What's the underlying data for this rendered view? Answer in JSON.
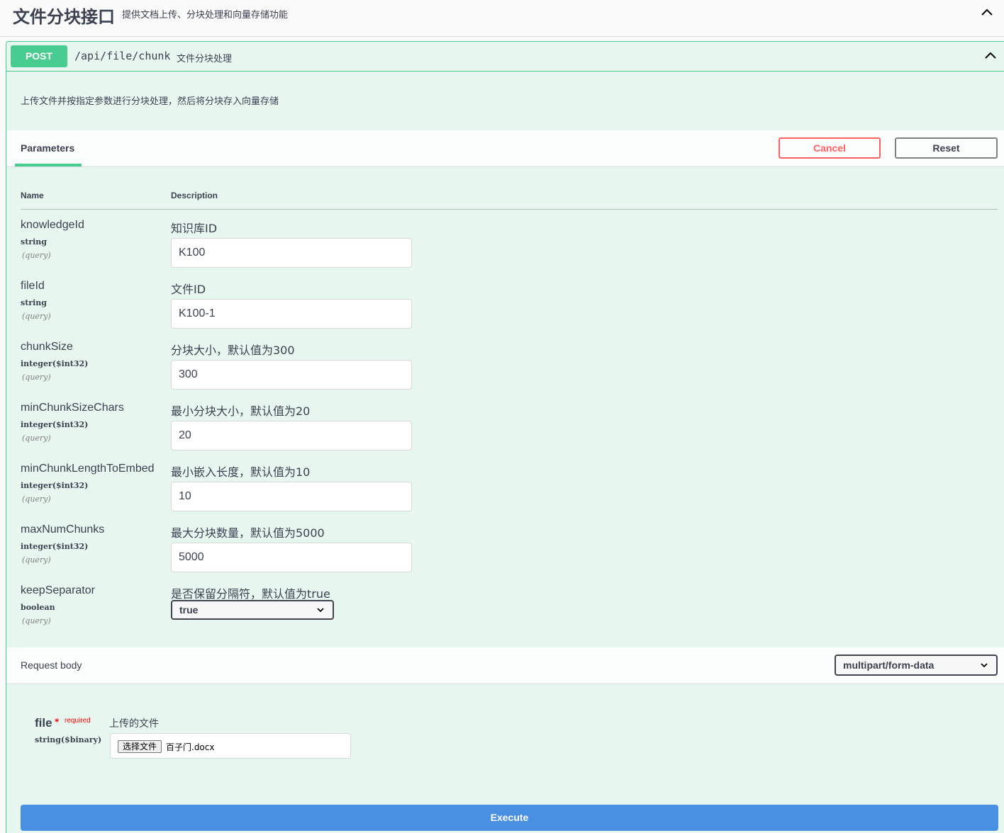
{
  "tag": {
    "title": "文件分块接口",
    "description": "提供文档上传、分块处理和向量存储功能",
    "collapse_icon": "chevron-up-icon"
  },
  "operation": {
    "method": "POST",
    "path": "/api/file/chunk",
    "summary": "文件分块处理",
    "description": "上传文件并按指定参数进行分块处理，然后将分块存入向量存储",
    "method_color": "#49cc90"
  },
  "parameters": {
    "tab_label": "Parameters",
    "cancel_label": "Cancel",
    "reset_label": "Reset",
    "col_name": "Name",
    "col_description": "Description",
    "items": [
      {
        "name": "knowledgeId",
        "type": "string",
        "in": "(query)",
        "description": "知识库ID",
        "value": "K100"
      },
      {
        "name": "fileId",
        "type": "string",
        "in": "(query)",
        "description": "文件ID",
        "value": "K100-1"
      },
      {
        "name": "chunkSize",
        "type": "integer($int32)",
        "in": "(query)",
        "description": "分块大小，默认值为300",
        "value": "300"
      },
      {
        "name": "minChunkSizeChars",
        "type": "integer($int32)",
        "in": "(query)",
        "description": "最小分块大小，默认值为20",
        "value": "20"
      },
      {
        "name": "minChunkLengthToEmbed",
        "type": "integer($int32)",
        "in": "(query)",
        "description": "最小嵌入长度，默认值为10",
        "value": "10"
      },
      {
        "name": "maxNumChunks",
        "type": "integer($int32)",
        "in": "(query)",
        "description": "最大分块数量，默认值为5000",
        "value": "5000"
      },
      {
        "name": "keepSeparator",
        "type": "boolean",
        "in": "(query)",
        "description": "是否保留分隔符，默认值为true",
        "value": "true"
      }
    ]
  },
  "request_body": {
    "title": "Request body",
    "content_type": "multipart/form-data",
    "file": {
      "name": "file",
      "required_star": "*",
      "required_label": "required",
      "type": "string($binary)",
      "description": "上传的文件",
      "button_label": "选择文件",
      "chosen_file": "百子门.docx"
    }
  },
  "execute_label": "Execute",
  "colors": {
    "accent": "#49cc90",
    "cancel": "#ff6060",
    "execute": "#4990e2"
  }
}
